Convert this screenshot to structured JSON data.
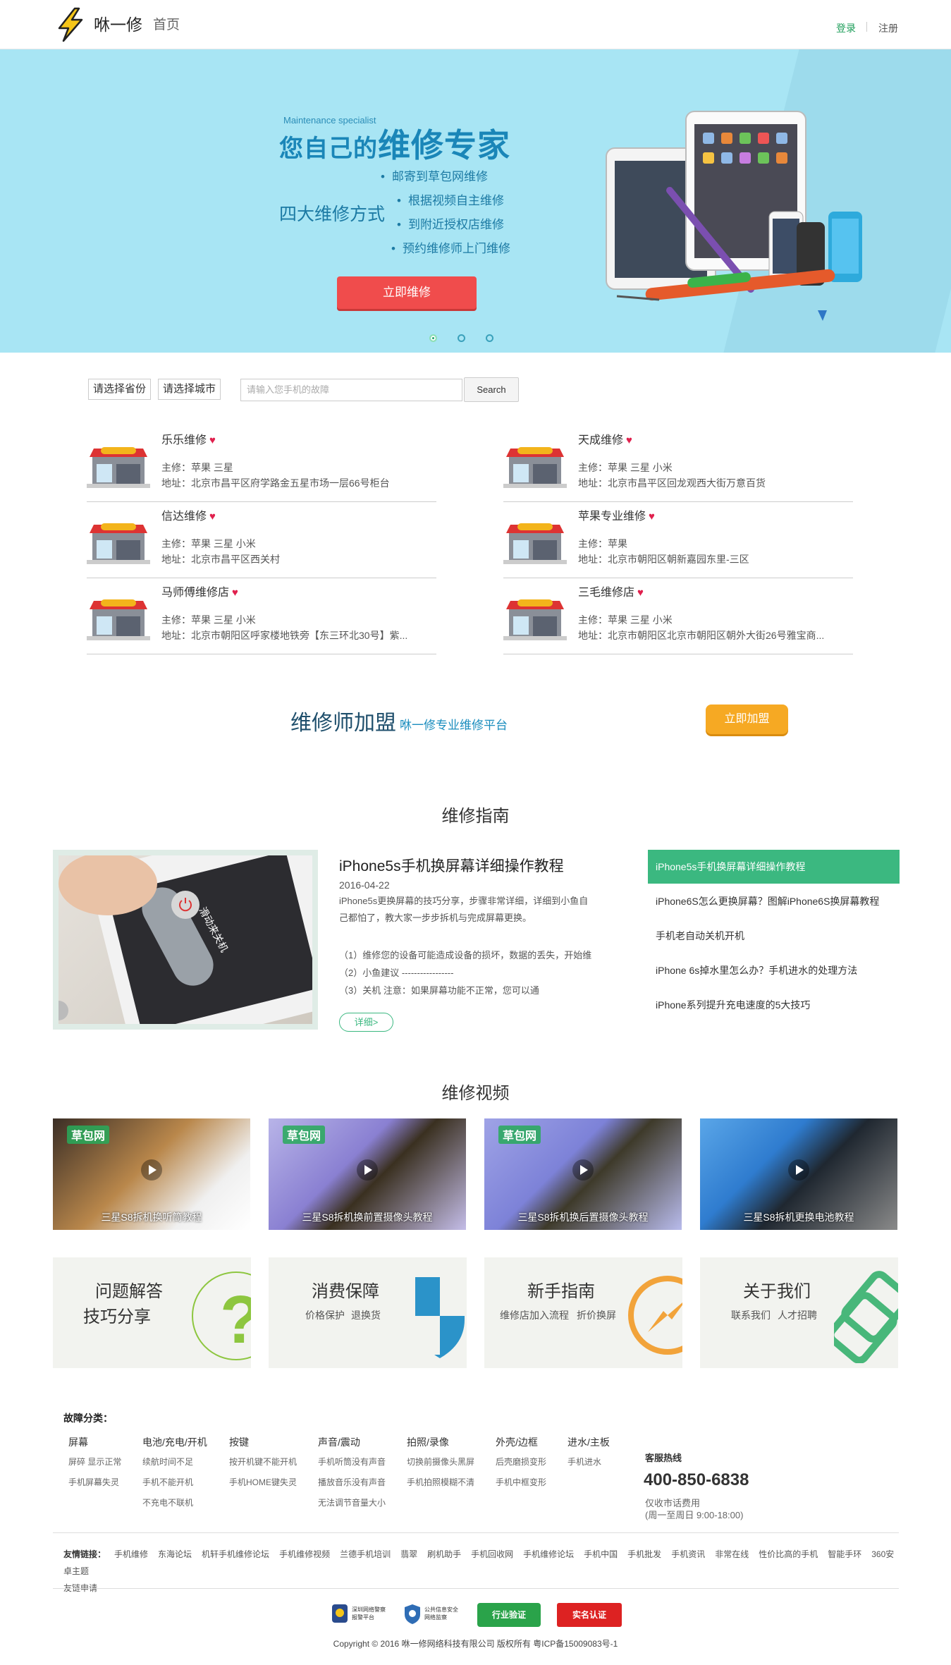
{
  "header": {
    "logo": "咻一修",
    "home": "首页",
    "login": "登录",
    "register": "注册"
  },
  "banner": {
    "subtitle": "Maintenance specialist",
    "title_small": "您自己的",
    "title_big": "维修专家",
    "four_ways": "四大维修方式",
    "ways": [
      "邮寄到草包网维修",
      "根据视频自主维修",
      "到附近授权店维修",
      "预约维修师上门维修"
    ],
    "cta": "立即维修"
  },
  "search": {
    "province": "请选择省份",
    "city": "请选择城市",
    "placeholder": "请输入您手机的故障",
    "button": "Search"
  },
  "shops": [
    {
      "name": "乐乐维修",
      "main": "主修：苹果 三星",
      "addr": "地址：北京市昌平区府学路金五星市场一层66号柜台"
    },
    {
      "name": "天成维修",
      "main": "主修：苹果 三星 小米",
      "addr": "地址：北京市昌平区回龙观西大街万意百货"
    },
    {
      "name": "信达维修",
      "main": "主修：苹果 三星 小米",
      "addr": "地址：北京市昌平区西关村"
    },
    {
      "name": "苹果专业维修",
      "main": "主修：苹果",
      "addr": "地址：北京市朝阳区朝新嘉园东里-三区"
    },
    {
      "name": "马师傅维修店",
      "main": "主修：苹果 三星 小米",
      "addr": "地址：北京市朝阳区呼家楼地铁旁【东三环北30号】紫..."
    },
    {
      "name": "三毛维修店",
      "main": "主修：苹果 三星 小米",
      "addr": "地址：北京市朝阳区北京市朝阳区朝外大街26号雅宝商..."
    }
  ],
  "join": {
    "title": "维修师加盟",
    "subtitle": "咻一修专业维修平台",
    "button": "立即加盟"
  },
  "guide": {
    "section_title": "维修指南",
    "image_text": "滑动来关机",
    "title": "iPhone5s手机换屏幕详细操作教程",
    "date": "2016-04-22",
    "lines": [
      "iPhone5s更换屏幕的技巧分享，步骤非常详细，详细到小鱼自",
      "己都怕了，教大家一步步拆机与完成屏幕更换。",
      "",
      "（1）维修您的设备可能造成设备的损坏，数据的丢失，开始维",
      "（2）小鱼建议 -----------------",
      "（3）关机 注意：如果屏幕功能不正常，您可以通"
    ],
    "more": "详细>",
    "list": [
      "iPhone5s手机换屏幕详细操作教程",
      "iPhone6S怎么更换屏幕？图解iPhone6S换屏幕教程",
      "手机老自动关机开机",
      "iPhone 6s掉水里怎么办？手机进水的处理方法",
      "iPhone系列提升充电速度的5大技巧"
    ]
  },
  "videos": {
    "section_title": "维修视频",
    "brand": "草包网",
    "items": [
      "三星S8拆机换听筒教程",
      "三星S8拆机换前置摄像头教程",
      "三星S8拆机换后置摄像头教程",
      "三星S8拆机更换电池教程"
    ]
  },
  "cards": [
    {
      "title1": "问题解答",
      "title2": "技巧分享"
    },
    {
      "title": "消费保障",
      "links": [
        "价格保护",
        "退换货"
      ]
    },
    {
      "title": "新手指南",
      "links": [
        "维修店加入流程",
        "折价换屏"
      ]
    },
    {
      "title": "关于我们",
      "links": [
        "联系我们",
        "人才招聘"
      ]
    }
  ],
  "footer": {
    "cat_head": "故障分类：",
    "columns": [
      {
        "head": "屏幕",
        "items": [
          "屏碎 显示正常",
          "手机屏幕失灵"
        ]
      },
      {
        "head": "电池/充电/开机",
        "items": [
          "续航时间不足",
          "手机不能开机",
          "不充电不联机"
        ]
      },
      {
        "head": "按键",
        "items": [
          "按开机键不能开机",
          "手机HOME键失灵"
        ]
      },
      {
        "head": "声音/震动",
        "items": [
          "手机听筒没有声音",
          "播放音乐没有声音",
          "无法调节音量大小"
        ]
      },
      {
        "head": "拍照/录像",
        "items": [
          "切换前摄像头黑屏",
          "手机拍照模糊不清"
        ]
      },
      {
        "head": "外壳/边框",
        "items": [
          "后壳磨损变形",
          "手机中框变形"
        ]
      },
      {
        "head": "进水/主板",
        "items": [
          "手机进水"
        ]
      }
    ],
    "hotline_head": "客服热线",
    "hotline": "400-850-6838",
    "hotline_note": "仅收市话费用",
    "hotline_time": "(周一至周日 9:00-18:00)",
    "links_head": "友情链接：",
    "links": [
      "手机维修",
      "东海论坛",
      "机轩手机维修论坛",
      "手机维修视频",
      "兰德手机培训",
      "翡翠",
      "刷机助手",
      "手机回收网",
      "手机维修论坛",
      "手机中国",
      "手机批发",
      "手机资讯",
      "非常在线",
      "性价比高的手机",
      "智能手环",
      "360安卓主题",
      "友链申请"
    ],
    "badges": [
      "深圳网络警察报警平台",
      "公共信息安全网络监察",
      "行业验证",
      "实名认证"
    ],
    "copyright": "Copyright © 2016 咻一修网络科技有限公司 版权所有 粤ICP备15009083号-1"
  },
  "colors": {
    "green": "#3bb880",
    "banner_bg": "#a8e5f4",
    "cta_red": "#f04c4c",
    "join_orange": "#f6a923"
  }
}
